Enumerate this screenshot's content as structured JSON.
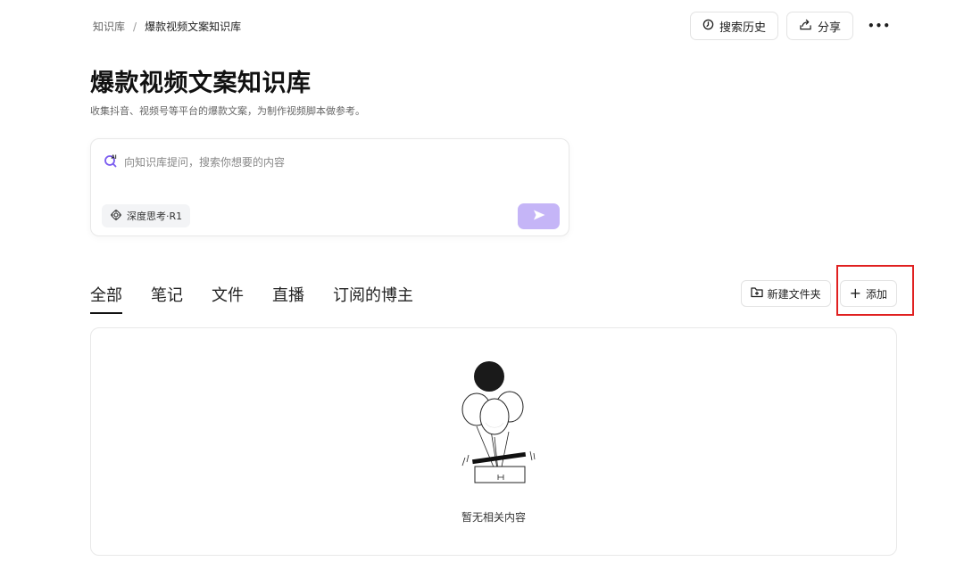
{
  "breadcrumb": {
    "root": "知识库",
    "separator": "/",
    "current": "爆款视频文案知识库"
  },
  "top_actions": {
    "history_label": "搜索历史",
    "share_label": "分享",
    "more_label": "•••"
  },
  "page": {
    "title": "爆款视频文案知识库",
    "subtitle": "收集抖音、视频号等平台的爆款文案，为制作视频脚本做参考。"
  },
  "ask_box": {
    "placeholder": "向知识库提问，搜索你想要的内容",
    "deep_think_label": "深度思考·R1"
  },
  "tabs": [
    {
      "label": "全部",
      "active": true
    },
    {
      "label": "笔记",
      "active": false
    },
    {
      "label": "文件",
      "active": false
    },
    {
      "label": "直播",
      "active": false
    },
    {
      "label": "订阅的博主",
      "active": false
    }
  ],
  "tools": {
    "new_folder_label": "新建文件夹",
    "add_label": "添加"
  },
  "empty_state": {
    "text": "暂无相关内容"
  },
  "colors": {
    "accent": "#7b5cf0",
    "send_button": "#c5b5f7",
    "highlight": "#e02020"
  }
}
